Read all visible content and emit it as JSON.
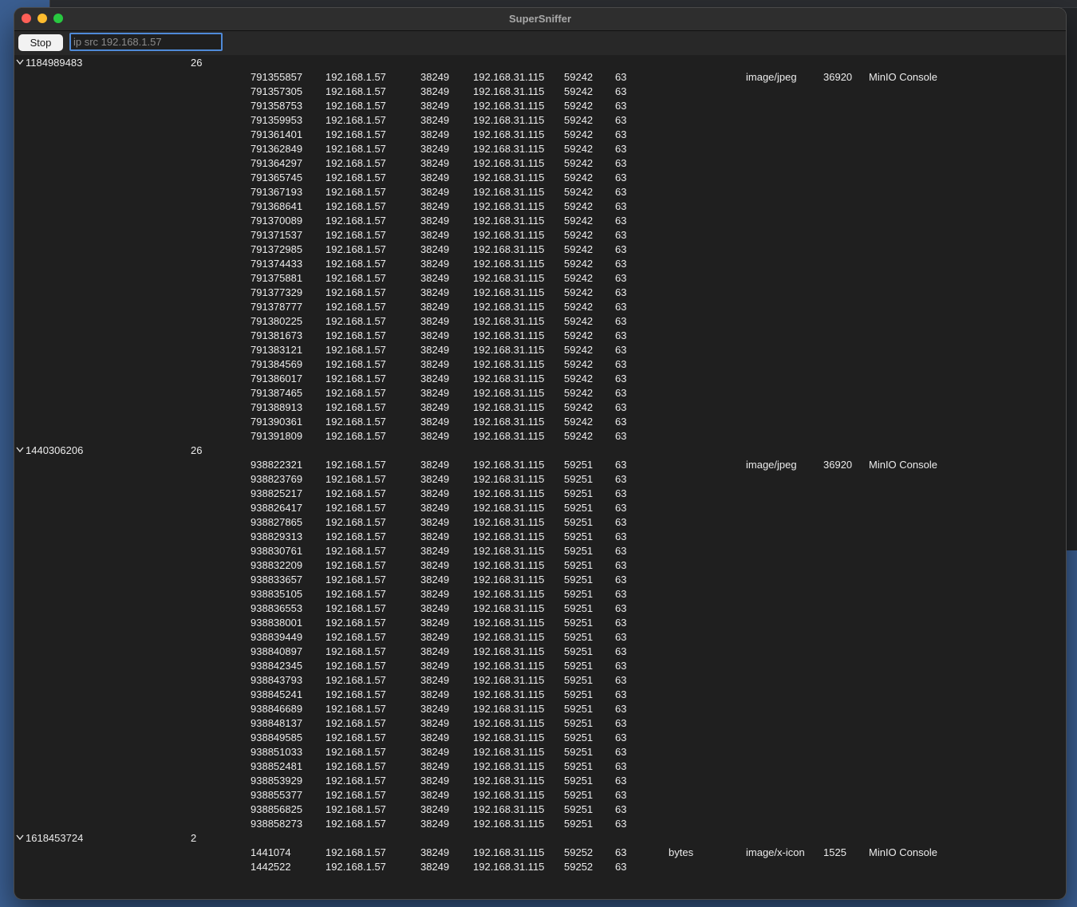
{
  "window": {
    "title": "SuperSniffer"
  },
  "toolbar": {
    "stop_label": "Stop",
    "filter_value": "ip src 192.168.1.57"
  },
  "groups": [
    {
      "id": "1184989483",
      "count": "26",
      "packets": [
        {
          "seq": "791355857",
          "src": "192.168.1.57",
          "sport": "38249",
          "dst": "192.168.31.115",
          "dport": "59242",
          "ttl": "63",
          "range": "",
          "mime": "image/jpeg",
          "size": "36920",
          "title": "MinIO Console"
        },
        {
          "seq": "791357305",
          "src": "192.168.1.57",
          "sport": "38249",
          "dst": "192.168.31.115",
          "dport": "59242",
          "ttl": "63"
        },
        {
          "seq": "791358753",
          "src": "192.168.1.57",
          "sport": "38249",
          "dst": "192.168.31.115",
          "dport": "59242",
          "ttl": "63"
        },
        {
          "seq": "791359953",
          "src": "192.168.1.57",
          "sport": "38249",
          "dst": "192.168.31.115",
          "dport": "59242",
          "ttl": "63"
        },
        {
          "seq": "791361401",
          "src": "192.168.1.57",
          "sport": "38249",
          "dst": "192.168.31.115",
          "dport": "59242",
          "ttl": "63"
        },
        {
          "seq": "791362849",
          "src": "192.168.1.57",
          "sport": "38249",
          "dst": "192.168.31.115",
          "dport": "59242",
          "ttl": "63"
        },
        {
          "seq": "791364297",
          "src": "192.168.1.57",
          "sport": "38249",
          "dst": "192.168.31.115",
          "dport": "59242",
          "ttl": "63"
        },
        {
          "seq": "791365745",
          "src": "192.168.1.57",
          "sport": "38249",
          "dst": "192.168.31.115",
          "dport": "59242",
          "ttl": "63"
        },
        {
          "seq": "791367193",
          "src": "192.168.1.57",
          "sport": "38249",
          "dst": "192.168.31.115",
          "dport": "59242",
          "ttl": "63"
        },
        {
          "seq": "791368641",
          "src": "192.168.1.57",
          "sport": "38249",
          "dst": "192.168.31.115",
          "dport": "59242",
          "ttl": "63"
        },
        {
          "seq": "791370089",
          "src": "192.168.1.57",
          "sport": "38249",
          "dst": "192.168.31.115",
          "dport": "59242",
          "ttl": "63"
        },
        {
          "seq": "791371537",
          "src": "192.168.1.57",
          "sport": "38249",
          "dst": "192.168.31.115",
          "dport": "59242",
          "ttl": "63"
        },
        {
          "seq": "791372985",
          "src": "192.168.1.57",
          "sport": "38249",
          "dst": "192.168.31.115",
          "dport": "59242",
          "ttl": "63"
        },
        {
          "seq": "791374433",
          "src": "192.168.1.57",
          "sport": "38249",
          "dst": "192.168.31.115",
          "dport": "59242",
          "ttl": "63"
        },
        {
          "seq": "791375881",
          "src": "192.168.1.57",
          "sport": "38249",
          "dst": "192.168.31.115",
          "dport": "59242",
          "ttl": "63"
        },
        {
          "seq": "791377329",
          "src": "192.168.1.57",
          "sport": "38249",
          "dst": "192.168.31.115",
          "dport": "59242",
          "ttl": "63"
        },
        {
          "seq": "791378777",
          "src": "192.168.1.57",
          "sport": "38249",
          "dst": "192.168.31.115",
          "dport": "59242",
          "ttl": "63"
        },
        {
          "seq": "791380225",
          "src": "192.168.1.57",
          "sport": "38249",
          "dst": "192.168.31.115",
          "dport": "59242",
          "ttl": "63"
        },
        {
          "seq": "791381673",
          "src": "192.168.1.57",
          "sport": "38249",
          "dst": "192.168.31.115",
          "dport": "59242",
          "ttl": "63"
        },
        {
          "seq": "791383121",
          "src": "192.168.1.57",
          "sport": "38249",
          "dst": "192.168.31.115",
          "dport": "59242",
          "ttl": "63"
        },
        {
          "seq": "791384569",
          "src": "192.168.1.57",
          "sport": "38249",
          "dst": "192.168.31.115",
          "dport": "59242",
          "ttl": "63"
        },
        {
          "seq": "791386017",
          "src": "192.168.1.57",
          "sport": "38249",
          "dst": "192.168.31.115",
          "dport": "59242",
          "ttl": "63"
        },
        {
          "seq": "791387465",
          "src": "192.168.1.57",
          "sport": "38249",
          "dst": "192.168.31.115",
          "dport": "59242",
          "ttl": "63"
        },
        {
          "seq": "791388913",
          "src": "192.168.1.57",
          "sport": "38249",
          "dst": "192.168.31.115",
          "dport": "59242",
          "ttl": "63"
        },
        {
          "seq": "791390361",
          "src": "192.168.1.57",
          "sport": "38249",
          "dst": "192.168.31.115",
          "dport": "59242",
          "ttl": "63"
        },
        {
          "seq": "791391809",
          "src": "192.168.1.57",
          "sport": "38249",
          "dst": "192.168.31.115",
          "dport": "59242",
          "ttl": "63"
        }
      ]
    },
    {
      "id": "1440306206",
      "count": "26",
      "packets": [
        {
          "seq": "938822321",
          "src": "192.168.1.57",
          "sport": "38249",
          "dst": "192.168.31.115",
          "dport": "59251",
          "ttl": "63",
          "range": "",
          "mime": "image/jpeg",
          "size": "36920",
          "title": "MinIO Console"
        },
        {
          "seq": "938823769",
          "src": "192.168.1.57",
          "sport": "38249",
          "dst": "192.168.31.115",
          "dport": "59251",
          "ttl": "63"
        },
        {
          "seq": "938825217",
          "src": "192.168.1.57",
          "sport": "38249",
          "dst": "192.168.31.115",
          "dport": "59251",
          "ttl": "63"
        },
        {
          "seq": "938826417",
          "src": "192.168.1.57",
          "sport": "38249",
          "dst": "192.168.31.115",
          "dport": "59251",
          "ttl": "63"
        },
        {
          "seq": "938827865",
          "src": "192.168.1.57",
          "sport": "38249",
          "dst": "192.168.31.115",
          "dport": "59251",
          "ttl": "63"
        },
        {
          "seq": "938829313",
          "src": "192.168.1.57",
          "sport": "38249",
          "dst": "192.168.31.115",
          "dport": "59251",
          "ttl": "63"
        },
        {
          "seq": "938830761",
          "src": "192.168.1.57",
          "sport": "38249",
          "dst": "192.168.31.115",
          "dport": "59251",
          "ttl": "63"
        },
        {
          "seq": "938832209",
          "src": "192.168.1.57",
          "sport": "38249",
          "dst": "192.168.31.115",
          "dport": "59251",
          "ttl": "63"
        },
        {
          "seq": "938833657",
          "src": "192.168.1.57",
          "sport": "38249",
          "dst": "192.168.31.115",
          "dport": "59251",
          "ttl": "63"
        },
        {
          "seq": "938835105",
          "src": "192.168.1.57",
          "sport": "38249",
          "dst": "192.168.31.115",
          "dport": "59251",
          "ttl": "63"
        },
        {
          "seq": "938836553",
          "src": "192.168.1.57",
          "sport": "38249",
          "dst": "192.168.31.115",
          "dport": "59251",
          "ttl": "63"
        },
        {
          "seq": "938838001",
          "src": "192.168.1.57",
          "sport": "38249",
          "dst": "192.168.31.115",
          "dport": "59251",
          "ttl": "63"
        },
        {
          "seq": "938839449",
          "src": "192.168.1.57",
          "sport": "38249",
          "dst": "192.168.31.115",
          "dport": "59251",
          "ttl": "63"
        },
        {
          "seq": "938840897",
          "src": "192.168.1.57",
          "sport": "38249",
          "dst": "192.168.31.115",
          "dport": "59251",
          "ttl": "63"
        },
        {
          "seq": "938842345",
          "src": "192.168.1.57",
          "sport": "38249",
          "dst": "192.168.31.115",
          "dport": "59251",
          "ttl": "63"
        },
        {
          "seq": "938843793",
          "src": "192.168.1.57",
          "sport": "38249",
          "dst": "192.168.31.115",
          "dport": "59251",
          "ttl": "63"
        },
        {
          "seq": "938845241",
          "src": "192.168.1.57",
          "sport": "38249",
          "dst": "192.168.31.115",
          "dport": "59251",
          "ttl": "63"
        },
        {
          "seq": "938846689",
          "src": "192.168.1.57",
          "sport": "38249",
          "dst": "192.168.31.115",
          "dport": "59251",
          "ttl": "63"
        },
        {
          "seq": "938848137",
          "src": "192.168.1.57",
          "sport": "38249",
          "dst": "192.168.31.115",
          "dport": "59251",
          "ttl": "63"
        },
        {
          "seq": "938849585",
          "src": "192.168.1.57",
          "sport": "38249",
          "dst": "192.168.31.115",
          "dport": "59251",
          "ttl": "63"
        },
        {
          "seq": "938851033",
          "src": "192.168.1.57",
          "sport": "38249",
          "dst": "192.168.31.115",
          "dport": "59251",
          "ttl": "63"
        },
        {
          "seq": "938852481",
          "src": "192.168.1.57",
          "sport": "38249",
          "dst": "192.168.31.115",
          "dport": "59251",
          "ttl": "63"
        },
        {
          "seq": "938853929",
          "src": "192.168.1.57",
          "sport": "38249",
          "dst": "192.168.31.115",
          "dport": "59251",
          "ttl": "63"
        },
        {
          "seq": "938855377",
          "src": "192.168.1.57",
          "sport": "38249",
          "dst": "192.168.31.115",
          "dport": "59251",
          "ttl": "63"
        },
        {
          "seq": "938856825",
          "src": "192.168.1.57",
          "sport": "38249",
          "dst": "192.168.31.115",
          "dport": "59251",
          "ttl": "63"
        },
        {
          "seq": "938858273",
          "src": "192.168.1.57",
          "sport": "38249",
          "dst": "192.168.31.115",
          "dport": "59251",
          "ttl": "63"
        }
      ]
    },
    {
      "id": "1618453724",
      "count": "2",
      "packets": [
        {
          "seq": "1441074",
          "src": "192.168.1.57",
          "sport": "38249",
          "dst": "192.168.31.115",
          "dport": "59252",
          "ttl": "63",
          "range": "bytes",
          "mime": "image/x-icon",
          "size": "1525",
          "title": "MinIO Console"
        },
        {
          "seq": "1442522",
          "src": "192.168.1.57",
          "sport": "38249",
          "dst": "192.168.31.115",
          "dport": "59252",
          "ttl": "63"
        }
      ]
    }
  ]
}
